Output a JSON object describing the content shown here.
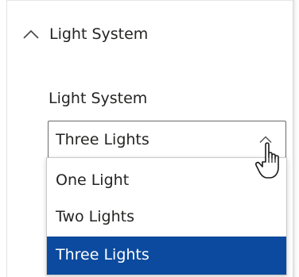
{
  "section": {
    "title": "Light System",
    "expanded": true,
    "icon": "chevron-up-icon"
  },
  "field": {
    "label": "Light System"
  },
  "select": {
    "value": "Three Lights",
    "icon": "chevron-up-icon",
    "options": [
      {
        "label": "One Light",
        "selected": false
      },
      {
        "label": "Two Lights",
        "selected": false
      },
      {
        "label": "Three Lights",
        "selected": true
      }
    ]
  },
  "cursor": {
    "icon": "hand-pointer-icon"
  },
  "colors": {
    "text": "#252423",
    "selected_bg": "#0b4a9e",
    "selected_text": "#ffffff",
    "border": "#6b6b6b"
  }
}
